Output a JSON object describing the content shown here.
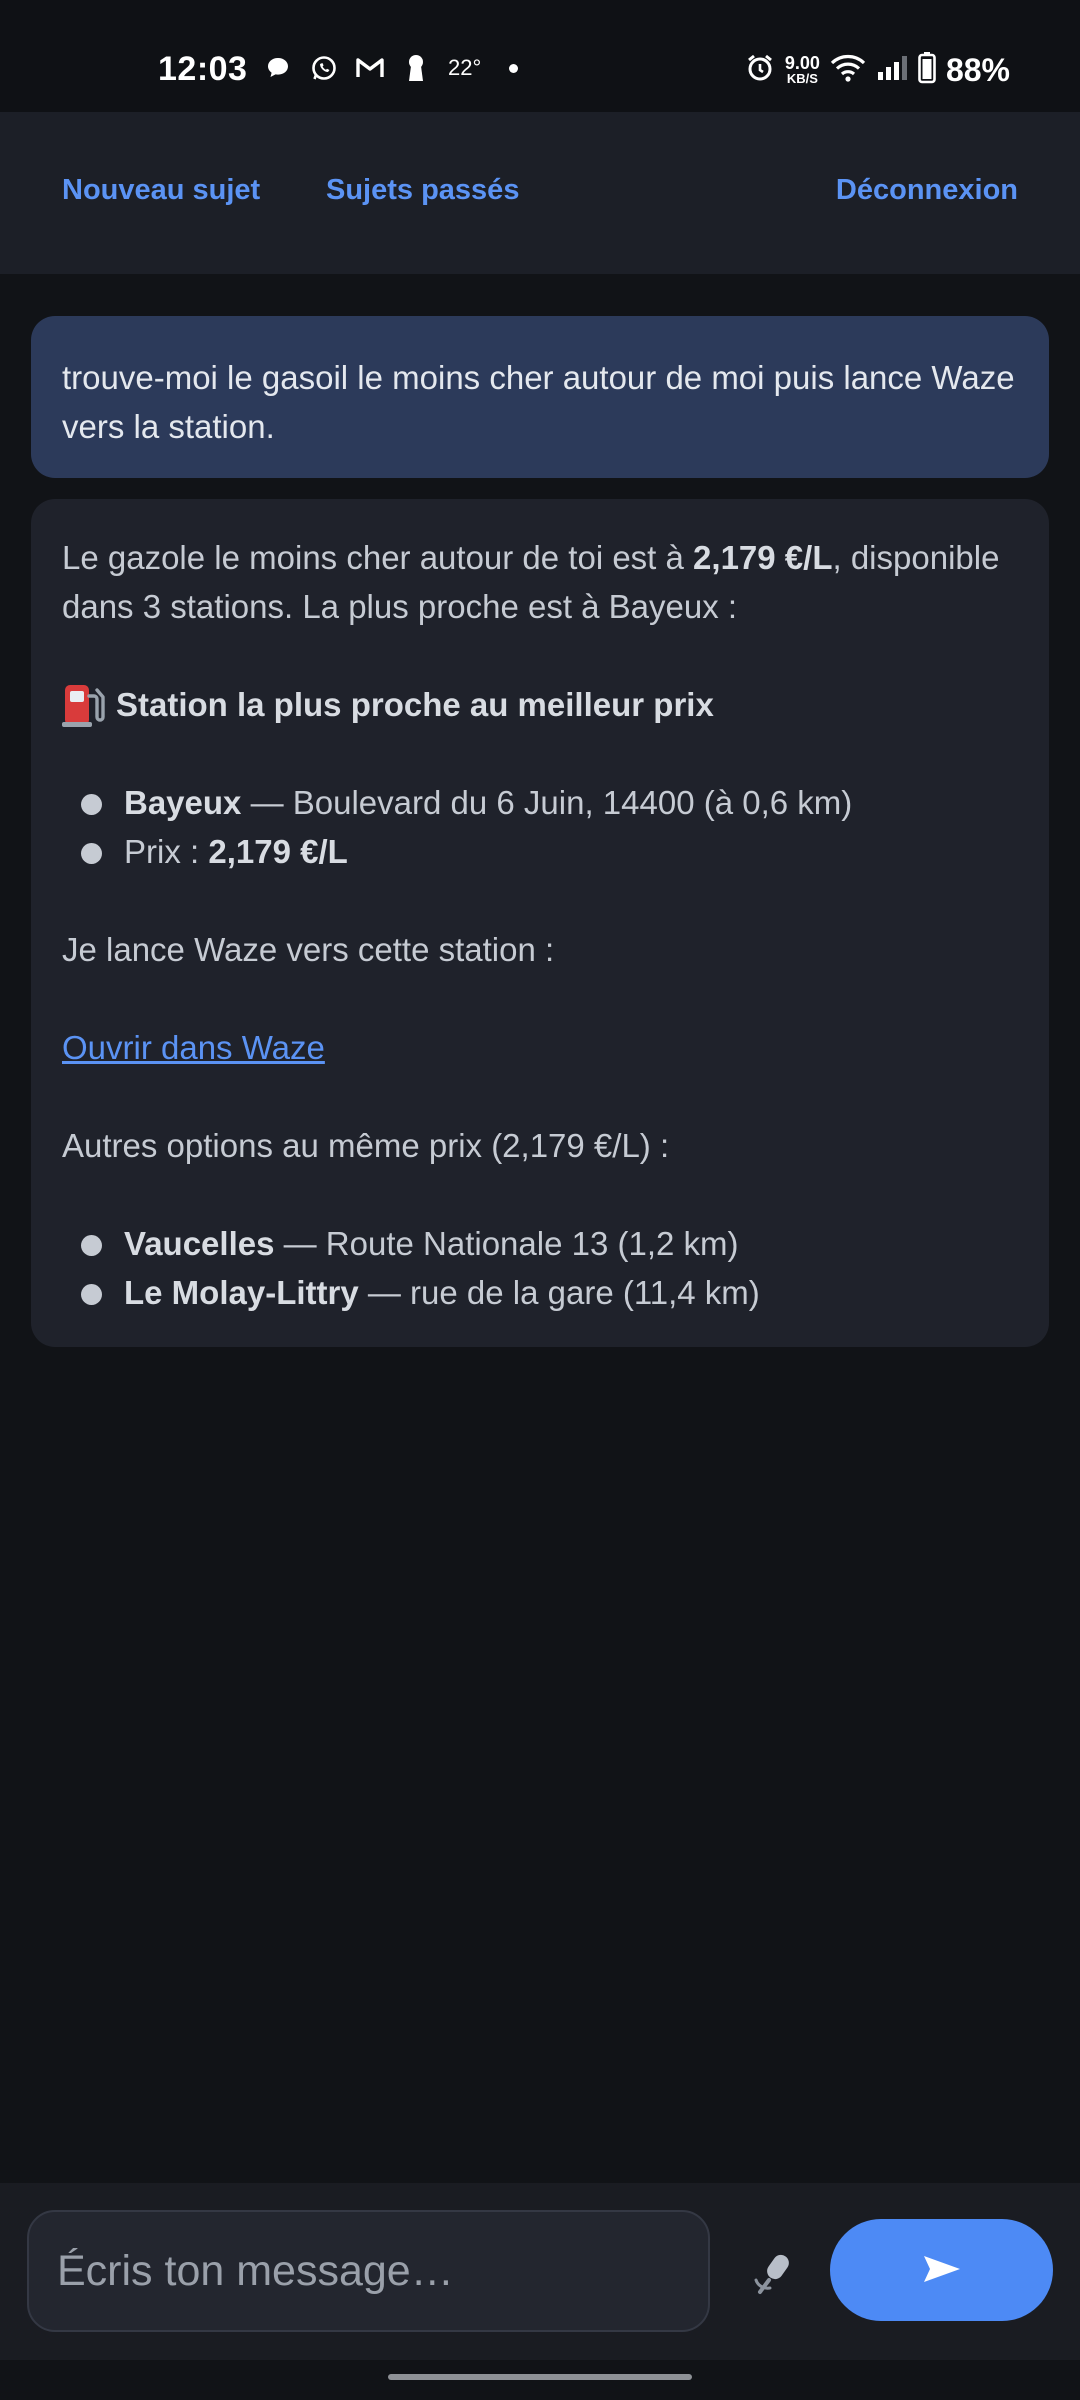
{
  "status_bar": {
    "time": "12:03",
    "temperature": "22°",
    "net_speed_value": "9.00",
    "net_speed_unit": "KB/S",
    "battery": "88%",
    "icons_left": [
      "chat-bubble-icon",
      "whatsapp-icon",
      "gmail-icon",
      "keyhole-icon"
    ],
    "icons_right": [
      "alarm-icon",
      "wifi-icon",
      "signal-icon",
      "battery-icon"
    ]
  },
  "nav": {
    "new_topic": "Nouveau sujet",
    "past_topics": "Sujets passés",
    "logout": "Déconnexion"
  },
  "user_message": {
    "text": "trouve-moi le gasoil le moins cher autour de moi puis lance Waze vers la station."
  },
  "bot_message": {
    "intro_part1": "Le gazole le moins cher autour de toi est à ",
    "intro_price": "2,179 €/L",
    "intro_part2": ", disponible dans 3 stations. La plus proche est à Bayeux :",
    "heading_icon": "fuel-pump-icon",
    "heading": "Station la plus proche au meilleur prix",
    "nearest": {
      "name": "Bayeux",
      "detail": " — Boulevard du 6 Juin, 14400 (à 0,6 km)",
      "price_label": "Prix : ",
      "price": "2,179 €/L"
    },
    "launch_text": "Je lance Waze vers cette station :",
    "waze_link": "Ouvrir dans Waze",
    "others_intro": "Autres options au même prix (2,179 €/L) :",
    "others": [
      {
        "name": "Vaucelles",
        "detail": " — Route Nationale 13 (1,2 km)"
      },
      {
        "name": "Le Molay-Littry",
        "detail": " — rue de la gare (11,4 km)"
      }
    ]
  },
  "composer": {
    "placeholder": "Écris ton message…",
    "mic_icon": "microphone-icon",
    "send_icon": "send-arrow-icon"
  },
  "colors": {
    "accent": "#4d8af5",
    "link": "#5b93f4",
    "background": "#111317",
    "user_bubble": "#2c3a5a",
    "bot_bubble": "#1f222b"
  }
}
